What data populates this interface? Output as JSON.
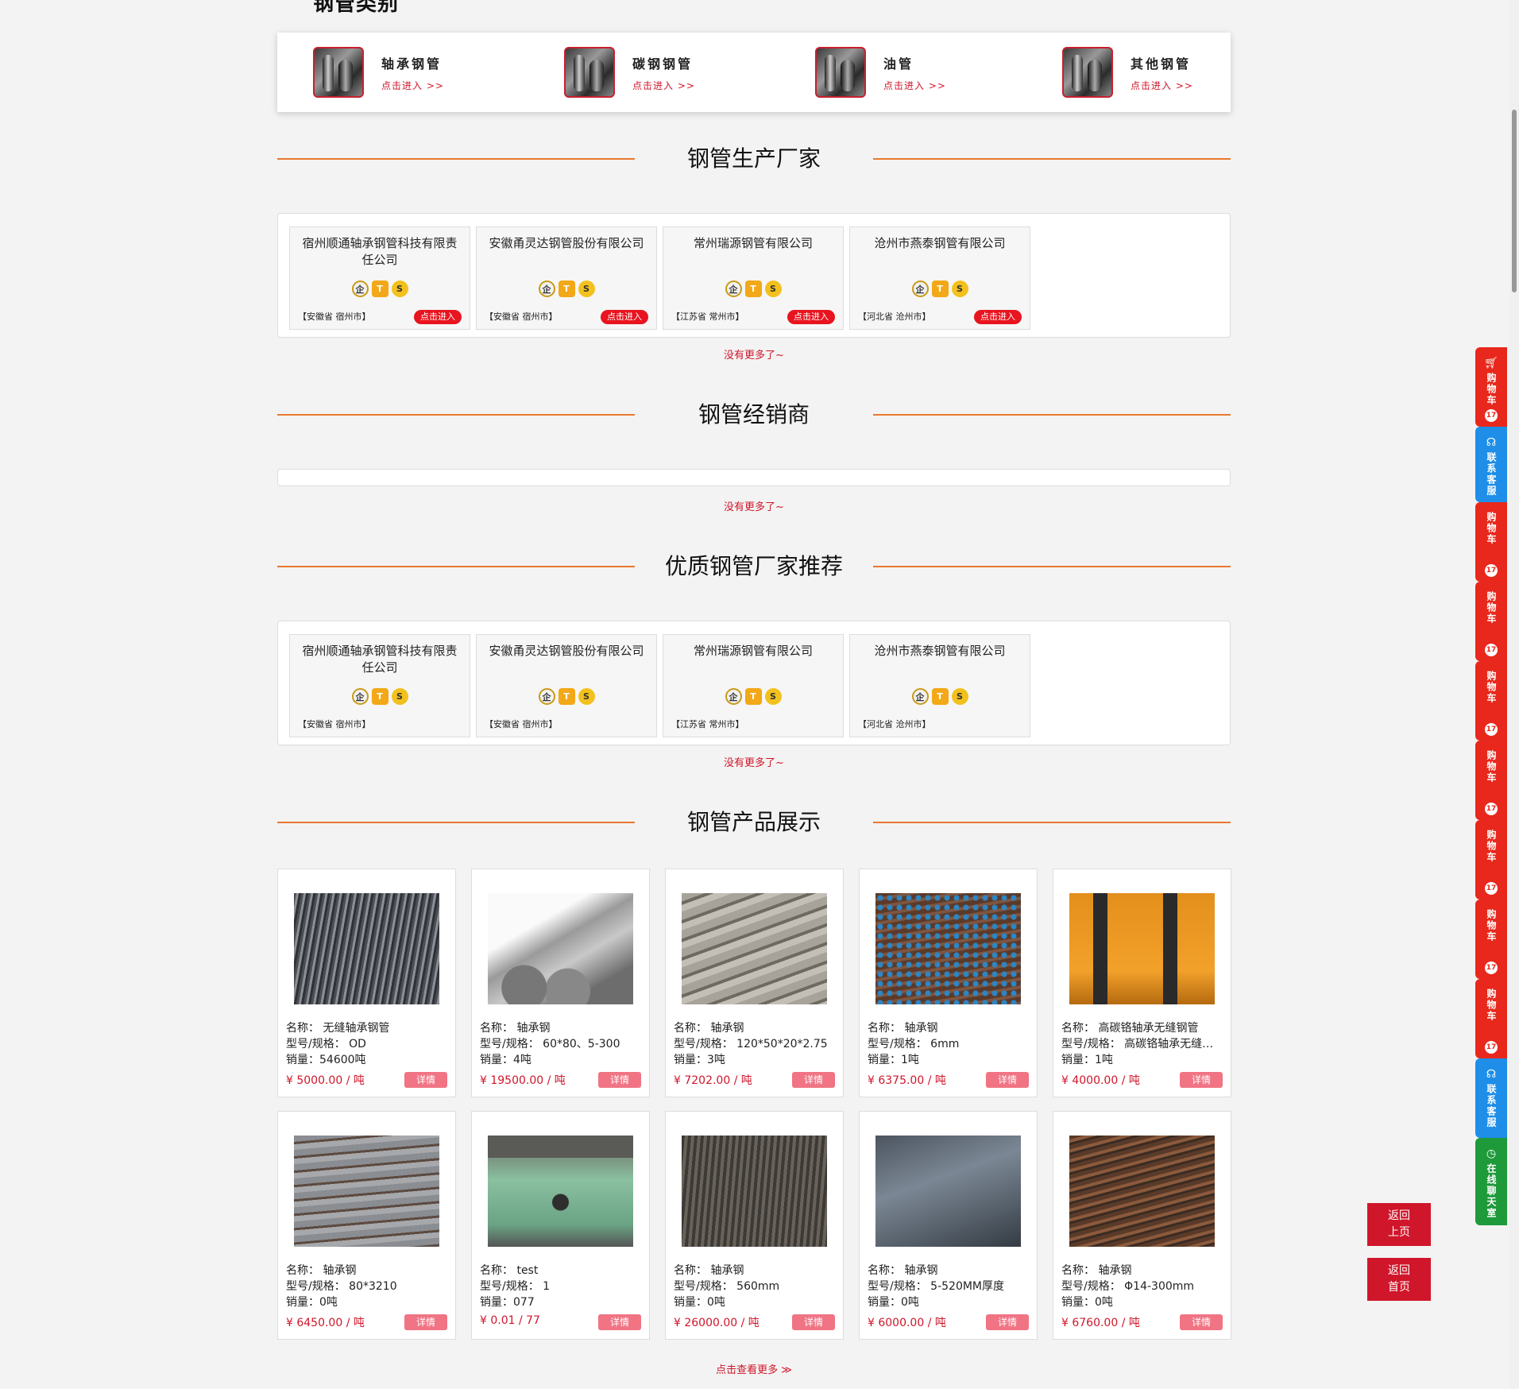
{
  "categories": {
    "title": "钢管类别",
    "items": [
      {
        "name": "轴承钢管",
        "link": "点击进入 >>"
      },
      {
        "name": "碳钢钢管",
        "link": "点击进入 >>"
      },
      {
        "name": "油管",
        "link": "点击进入 >>"
      },
      {
        "name": "其他钢管",
        "link": "点击进入 >>"
      }
    ]
  },
  "manufacturers": {
    "title": "钢管生产厂家",
    "no_more": "没有更多了~",
    "button_label": "点击进入",
    "badges": [
      "企",
      "T",
      "S"
    ],
    "cards": [
      {
        "name": "宿州顺通轴承钢管科技有限责任公司",
        "location": "【安徽省  宿州市】"
      },
      {
        "name": "安徽甬灵达钢管股份有限公司",
        "location": "【安徽省  宿州市】"
      },
      {
        "name": "常州瑞源钢管有限公司",
        "location": "【江苏省  常州市】"
      },
      {
        "name": "沧州市燕泰钢管有限公司",
        "location": "【河北省  沧州市】"
      }
    ]
  },
  "dealers": {
    "title": "钢管经销商",
    "no_more": "没有更多了~"
  },
  "recommended": {
    "title": "优质钢管厂家推荐",
    "no_more": "没有更多了~",
    "cards": [
      {
        "name": "宿州顺通轴承钢管科技有限责任公司",
        "location": "【安徽省  宿州市】"
      },
      {
        "name": "安徽甬灵达钢管股份有限公司",
        "location": "【安徽省  宿州市】"
      },
      {
        "name": "常州瑞源钢管有限公司",
        "location": "【江苏省  常州市】"
      },
      {
        "name": "沧州市燕泰钢管有限公司",
        "location": "【河北省  沧州市】"
      }
    ]
  },
  "products": {
    "title": "钢管产品展示",
    "detail_label": "详情",
    "more_label": "点击查看更多 ≫",
    "items": [
      {
        "name": "名称：  无缝轴承钢管",
        "spec": "型号/规格：  OD",
        "sales": "销量：54600吨",
        "price": "¥ 5000.00 / 吨"
      },
      {
        "name": "名称：  轴承钢",
        "spec": "型号/规格：  60*80、5-300",
        "sales": "销量：4吨",
        "price": "¥ 19500.00 / 吨"
      },
      {
        "name": "名称：  轴承钢",
        "spec": "型号/规格：  120*50*20*2.75",
        "sales": "销量：3吨",
        "price": "¥ 7202.00 / 吨"
      },
      {
        "name": "名称：  轴承钢",
        "spec": "型号/规格：  6mm",
        "sales": "销量：1吨",
        "price": "¥ 6375.00 / 吨"
      },
      {
        "name": "名称：  高碳铬轴承无缝钢管",
        "spec": "型号/规格：  高碳铬轴承无缝钢管",
        "sales": "销量：1吨",
        "price": "¥ 4000.00 / 吨"
      },
      {
        "name": "名称：  轴承钢",
        "spec": "型号/规格：  80*3210",
        "sales": "销量：0吨",
        "price": "¥ 6450.00 / 吨"
      },
      {
        "name": "名称：  test",
        "spec": "型号/规格：  1",
        "sales": "销量：077",
        "price": "¥ 0.01 / 77"
      },
      {
        "name": "名称：  轴承钢",
        "spec": "型号/规格：  560mm",
        "sales": "销量：0吨",
        "price": "¥ 26000.00 / 吨"
      },
      {
        "name": "名称：  轴承钢",
        "spec": "型号/规格：  5-520MM厚度",
        "sales": "销量：0吨",
        "price": "¥ 6000.00 / 吨"
      },
      {
        "name": "名称：  轴承钢",
        "spec": "型号/规格：  Φ14-300mm",
        "sales": "销量：0吨",
        "price": "¥ 6760.00 / 吨"
      }
    ]
  },
  "sidebar": {
    "cart_label": "购物车",
    "cart_count": "17",
    "service_label": "联系客服",
    "chat_label": "在线聊天室"
  },
  "back_buttons": {
    "prev_line1": "返回",
    "prev_line2": "上页",
    "home_line1": "返回",
    "home_line2": "首页"
  }
}
